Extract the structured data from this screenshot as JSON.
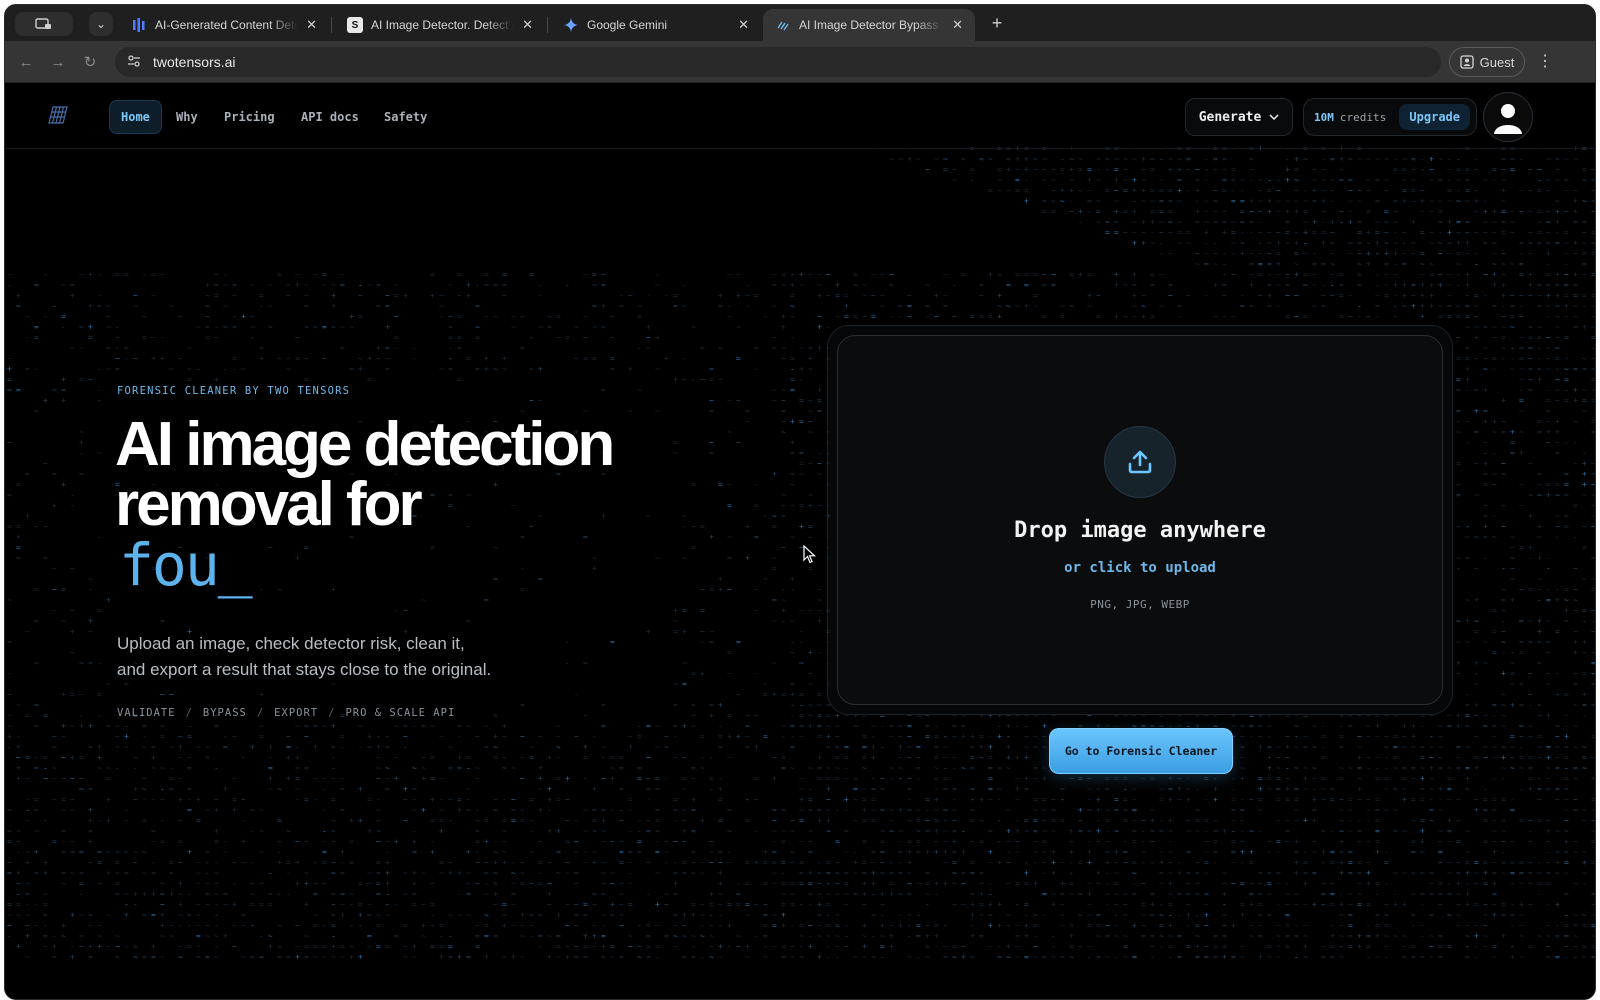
{
  "browser": {
    "tabs": [
      {
        "title": "AI-Generated Content Detect",
        "favicon": "bars-icon",
        "active": false
      },
      {
        "title": "AI Image Detector. Detect AI-",
        "favicon": "S",
        "active": false
      },
      {
        "title": "Google Gemini",
        "favicon": "gemini-icon",
        "active": false
      },
      {
        "title": "AI Image Detector Bypass | Fo",
        "favicon": "tt-icon",
        "active": true
      }
    ],
    "url": "twotensors.ai",
    "profile_label": "Guest"
  },
  "nav": {
    "links": [
      {
        "label": "Home",
        "active": true
      },
      {
        "label": "Why",
        "active": false
      },
      {
        "label": "Pricing",
        "active": false
      },
      {
        "label": "API docs",
        "active": false
      },
      {
        "label": "Safety",
        "active": false
      }
    ],
    "generate_label": "Generate",
    "credits_value": "10M",
    "credits_label": "credits",
    "upgrade_label": "Upgrade"
  },
  "hero": {
    "eyebrow": "FORENSIC CLEANER BY TWO TENSORS",
    "title_line1": "AI image detection",
    "title_line2": "removal for",
    "typed_text": "fou_",
    "lead_line1": "Upload an image, check detector risk, clean it,",
    "lead_line2": "and export a result that stays close to the original.",
    "tags": [
      "VALIDATE",
      "BYPASS",
      "EXPORT",
      "PRO & SCALE API"
    ],
    "tag_separator": "/"
  },
  "upload": {
    "title": "Drop image anywhere",
    "subtitle": "or click to upload",
    "formats": "PNG, JPG, WEBP"
  },
  "cta_label": "Go to Forensic Cleaner",
  "colors": {
    "accent": "#6cb9ea",
    "background": "#000000",
    "cta": "#4aaef0"
  }
}
